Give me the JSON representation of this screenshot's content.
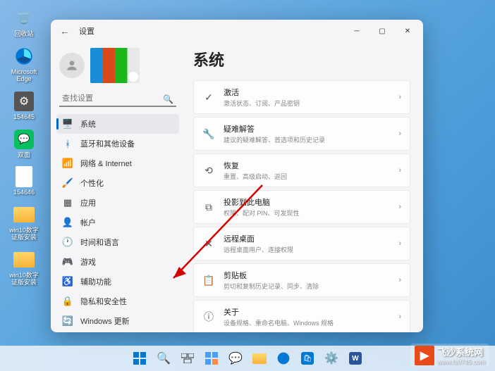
{
  "desktop": {
    "icons": [
      {
        "name": "recycle-bin",
        "label": "回收站",
        "glyph": "🗑️"
      },
      {
        "name": "edge",
        "label": "Microsoft Edge",
        "glyph": "🌐"
      },
      {
        "name": "file1",
        "label": "154645",
        "glyph": "⚙️"
      },
      {
        "name": "wechat",
        "label": "双面",
        "glyph": "💬"
      },
      {
        "name": "file2",
        "label": "154646",
        "glyph": "📄"
      },
      {
        "name": "folder1",
        "label": "win10数字证版安装",
        "glyph": "📁"
      },
      {
        "name": "folder2",
        "label": "win10数字证版安装",
        "glyph": "📁"
      }
    ]
  },
  "window": {
    "title": "设置",
    "search_placeholder": "查找设置",
    "nav": [
      {
        "icon": "🖥️",
        "label": "系统",
        "color": "#0067c0",
        "active": true
      },
      {
        "icon": "ᚼ",
        "label": "蓝牙和其他设备",
        "color": "#0067c0"
      },
      {
        "icon": "📶",
        "label": "网络 & Internet",
        "color": "#444"
      },
      {
        "icon": "🖌️",
        "label": "个性化",
        "color": "#444"
      },
      {
        "icon": "▦",
        "label": "应用",
        "color": "#444"
      },
      {
        "icon": "👤",
        "label": "帐户",
        "color": "#444"
      },
      {
        "icon": "🕐",
        "label": "时间和语言",
        "color": "#444"
      },
      {
        "icon": "🎮",
        "label": "游戏",
        "color": "#444"
      },
      {
        "icon": "♿",
        "label": "辅助功能",
        "color": "#444"
      },
      {
        "icon": "🔒",
        "label": "隐私和安全性",
        "color": "#444"
      },
      {
        "icon": "🔄",
        "label": "Windows 更新",
        "color": "#0067c0"
      }
    ],
    "content": {
      "heading": "系统",
      "cards": [
        {
          "icon": "✓",
          "title": "激活",
          "sub": "激活状态、订阅、产品密钥"
        },
        {
          "icon": "🔧",
          "title": "疑难解答",
          "sub": "建议的疑难解答、首选项和历史记录"
        },
        {
          "icon": "⟲",
          "title": "恢复",
          "sub": "重置、高级启动、返回"
        },
        {
          "icon": "⧉",
          "title": "投影到此电脑",
          "sub": "权限、配对 PIN、可发现性"
        },
        {
          "icon": "✕",
          "title": "远程桌面",
          "sub": "远程桌面用户、连接权限"
        },
        {
          "icon": "📋",
          "title": "剪贴板",
          "sub": "剪切和复制历史记录、同步、清除"
        },
        {
          "icon": "ⓘ",
          "title": "关于",
          "sub": "设备规格、重命名电脑、Windows 规格"
        }
      ]
    }
  },
  "taskbar": {
    "items": [
      "start",
      "search",
      "taskview",
      "widgets",
      "chat",
      "explorer",
      "edge",
      "store",
      "settings",
      "word"
    ]
  },
  "watermark": {
    "brand": "飞沙系统网",
    "url": "www.fs0745.com"
  }
}
